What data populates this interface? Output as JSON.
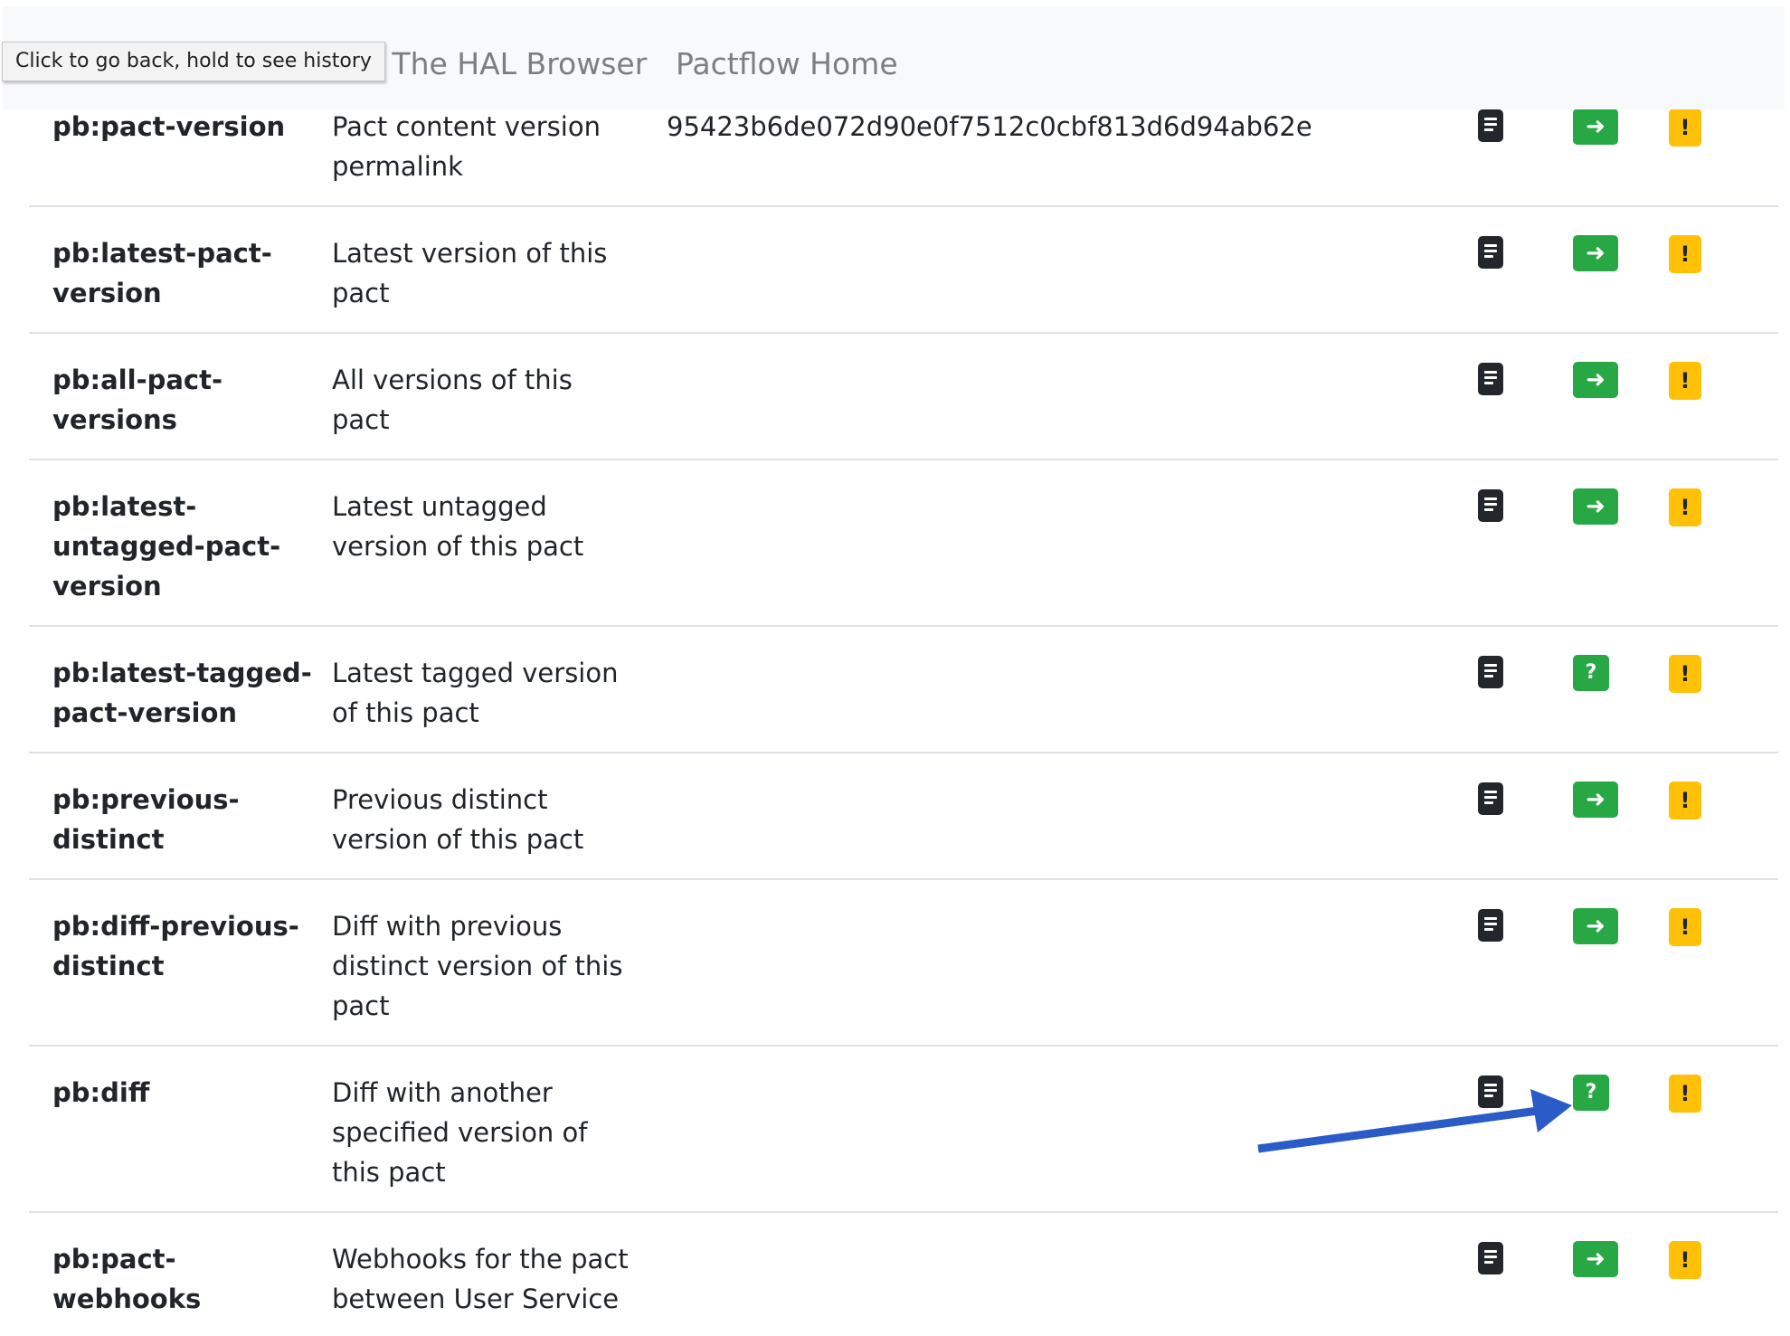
{
  "nav": {
    "tooltip": "Click to go back, hold to see history",
    "hal_browser": "t The HAL Browser",
    "pactflow_home": "Pactflow Home"
  },
  "links": [
    {
      "rel": "pb:pact-version",
      "title": "Pact content version permalink",
      "name": "95423b6de072d90e0f7512c0cbf813d6d94ab62e",
      "get_icon": "arrow-right-icon"
    },
    {
      "rel": "pb:latest-pact-version",
      "title": "Latest version of this pact",
      "name": "",
      "get_icon": "arrow-right-icon"
    },
    {
      "rel": "pb:all-pact-versions",
      "title": "All versions of this pact",
      "name": "",
      "get_icon": "arrow-right-icon"
    },
    {
      "rel": "pb:latest-untagged-pact-version",
      "title": "Latest untagged version of this pact",
      "name": "",
      "get_icon": "arrow-right-icon"
    },
    {
      "rel": "pb:latest-tagged-pact-version",
      "title": "Latest tagged version of this pact",
      "name": "",
      "get_icon": "question-mark-icon"
    },
    {
      "rel": "pb:previous-distinct",
      "title": "Previous distinct version of this pact",
      "name": "",
      "get_icon": "arrow-right-icon"
    },
    {
      "rel": "pb:diff-previous-distinct",
      "title": "Diff with previous distinct version of this pact",
      "name": "",
      "get_icon": "arrow-right-icon"
    },
    {
      "rel": "pb:diff",
      "title": "Diff with another specified version of this pact",
      "name": "",
      "get_icon": "question-mark-icon"
    },
    {
      "rel": "pb:pact-webhooks",
      "title": "Webhooks for the pact between User Service",
      "name": "",
      "get_icon": "arrow-right-icon"
    }
  ],
  "glyphs": {
    "arrow": "➜",
    "question": "?",
    "exclamation": "!"
  },
  "colors": {
    "go_button": "#28a745",
    "non_get_button": "#ffc107",
    "doc_button": "#23272b",
    "annotation_arrow": "#2a5bc6"
  }
}
